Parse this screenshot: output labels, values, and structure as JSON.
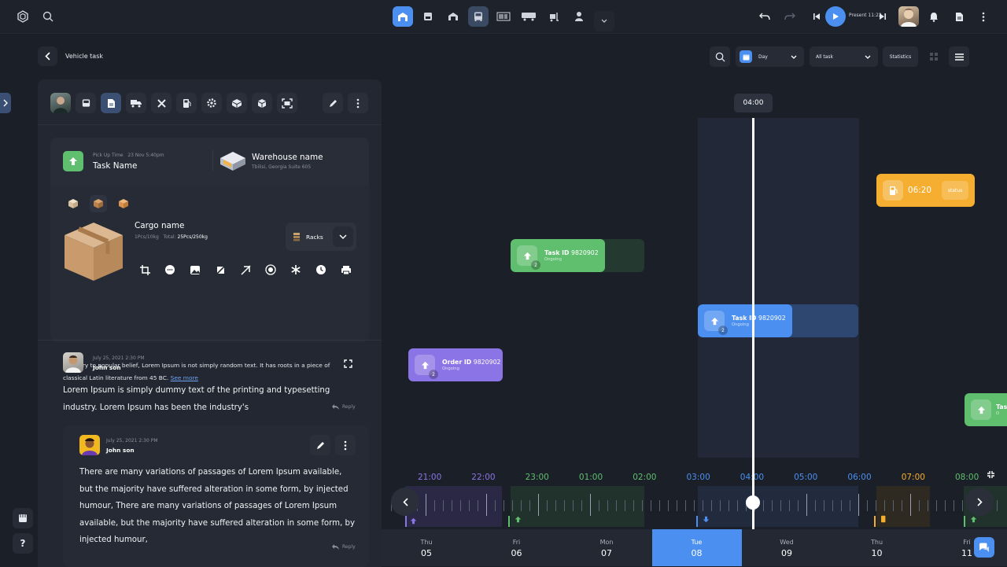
{
  "colors": {
    "accent": "#4b8ff0",
    "green": "#5fbf6e",
    "purple": "#8b74e6",
    "orange": "#f5ae2f",
    "bg": "#1b1f27"
  },
  "topbar": {
    "present_label": "Present 11:22"
  },
  "page": {
    "title": "Vehicle task"
  },
  "task": {
    "pickup_label": "Pick Up Time",
    "pickup_time": "23 Nov 5:40pm",
    "name": "Task Name",
    "warehouse_name": "Warehouse name",
    "warehouse_address": "Tbilisi, Georgia Suite 605"
  },
  "cargo": {
    "name": "Cargo name",
    "pcs": "1Pcs/10kg",
    "total_label": "Total:",
    "total_value": "25Pcs/250kg",
    "racks_label": "Racks"
  },
  "description": {
    "text": "Contrary to popular belief, Lorem Ipsum is not simply random text. It has roots in a piece of classical Latin literature from 45 BC.",
    "more": "See more"
  },
  "comments": [
    {
      "date": "July 25, 2021 2:30 PM",
      "author": "John son",
      "text": "Lorem Ipsum is simply dummy text of the printing and typesetting industry. Lorem Ipsum has been the industry's",
      "reply": "Reply"
    },
    {
      "date": "July 25, 2021 2:30 PM",
      "author": "John son",
      "text": "There are many variations of passages of Lorem Ipsum available, but the majority have suffered alteration in some form, by injected humour, There are many variations of passages of Lorem Ipsum available, but the majority have suffered alteration in some form, by injected humour,",
      "reply": "Reply"
    }
  ],
  "controls": {
    "day_select": "Day",
    "task_select": "All task",
    "statistics": "Statistics"
  },
  "timeline": {
    "current_time": "04:00",
    "status_card": {
      "time": "06:20",
      "status": "status"
    },
    "tasks": [
      {
        "label": "Task ID",
        "id": "9820902",
        "status": "Ongoing",
        "count": "2"
      },
      {
        "label": "Task ID",
        "id": "9820902",
        "status": "Ongoing",
        "count": "2"
      },
      {
        "label": "Order ID",
        "id": "9820902",
        "status": "Ongoing",
        "count": "2"
      },
      {
        "label": "Tas",
        "id": "",
        "status": "O",
        "count": ""
      }
    ],
    "hours": [
      "21:00",
      "22:00",
      "23:00",
      "01:00",
      "02:00",
      "03:00",
      "04:00",
      "05:00",
      "06:00",
      "07:00",
      "08:00"
    ],
    "days": [
      {
        "name": "Thu",
        "num": "05"
      },
      {
        "name": "Fri",
        "num": "06"
      },
      {
        "name": "Mon",
        "num": "07"
      },
      {
        "name": "Tue",
        "num": "08"
      },
      {
        "name": "Wed",
        "num": "09"
      },
      {
        "name": "Thu",
        "num": "10"
      },
      {
        "name": "Fri",
        "num": "11"
      }
    ]
  }
}
